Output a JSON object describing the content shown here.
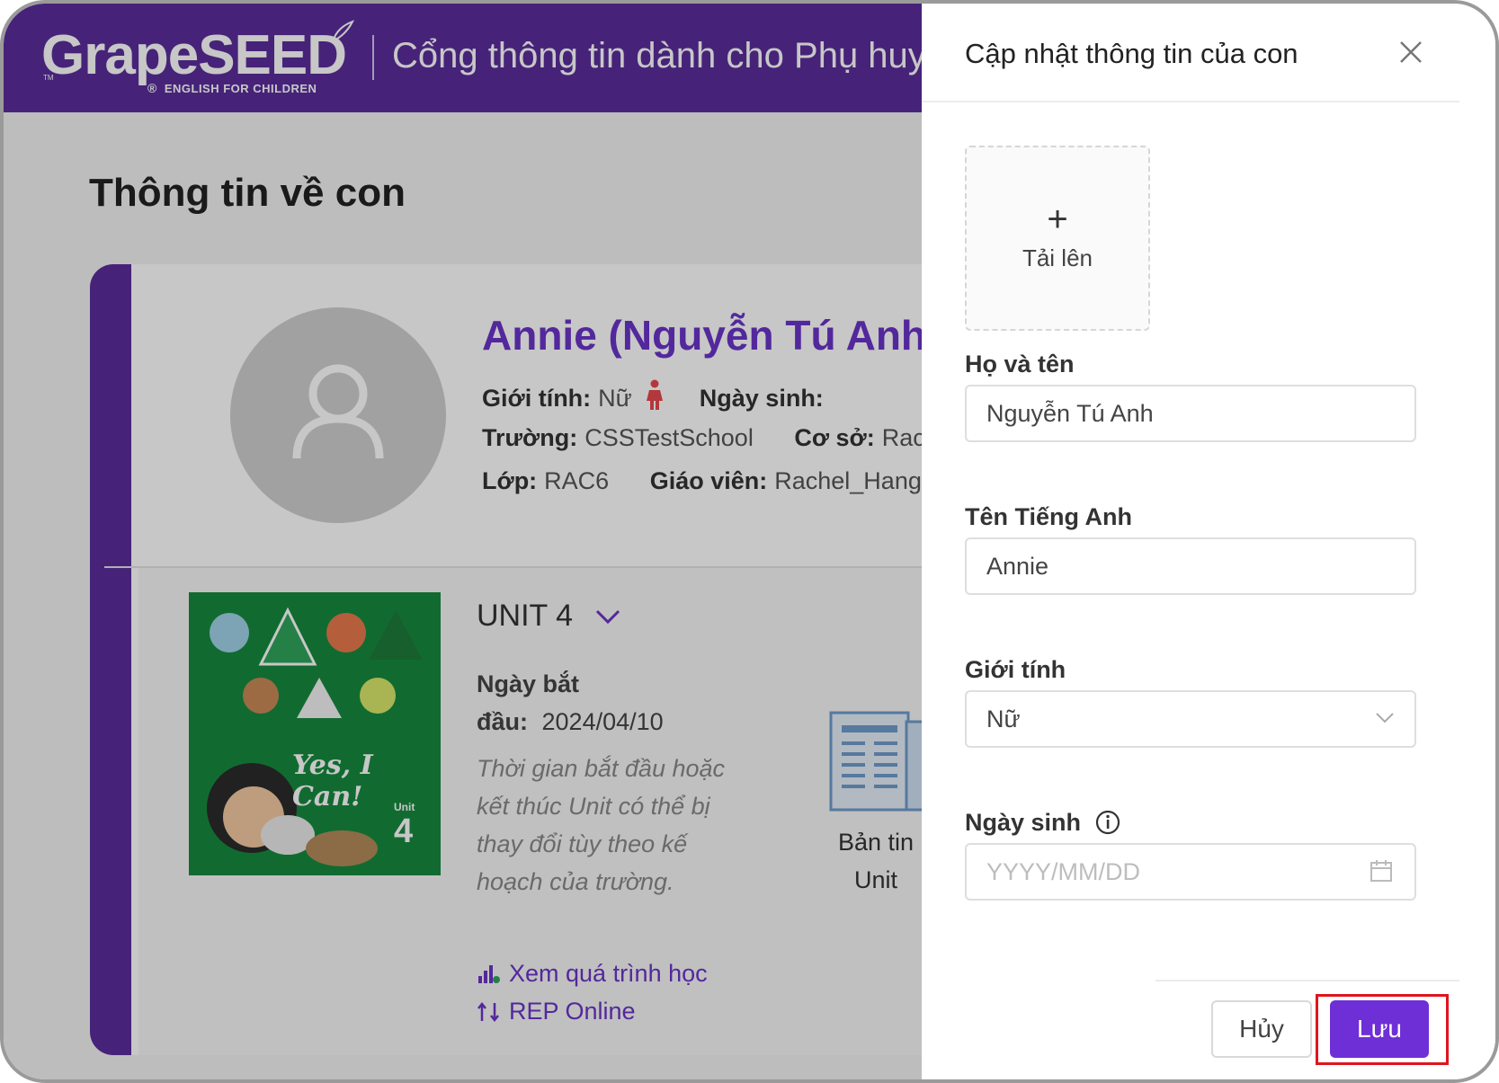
{
  "header": {
    "logo_text": "GrapeSEED",
    "logo_tm": "TM",
    "logo_tagline": "ENGLISH FOR CHILDREN",
    "portal_title": "Cổng thông tin dành cho Phụ huynh"
  },
  "page": {
    "title": "Thông tin về con"
  },
  "child": {
    "display_name": "Annie (Nguyễn Tú Anh)",
    "gender_label": "Giới tính:",
    "gender_value": "Nữ",
    "birthday_label": "Ngày sinh:",
    "birthday_value": "",
    "school_label": "Trường:",
    "school_value": "CSSTestSchool",
    "campus_label": "Cơ sở:",
    "campus_value": "Rachel",
    "class_label": "Lớp:",
    "class_value": "RAC6",
    "teacher_label": "Giáo viên:",
    "teacher_value": "Rachel_Hang"
  },
  "unit": {
    "title": "UNIT 4",
    "start_label_line1": "Ngày bắt",
    "start_label_line2": "đầu:",
    "start_date": "2024/04/10",
    "note": "Thời gian bắt đầu hoặc kết thúc Unit có thể bị thay đổi tùy theo kế hoạch của trường.",
    "view_progress_link": "Xem quá trình học",
    "rep_online_link": "REP Online",
    "newsletter_line1": "Bản tin",
    "newsletter_line2": "Unit",
    "book_title": "Yes, I Can!",
    "book_unit_label": "Unit",
    "book_unit_number": "4"
  },
  "drawer": {
    "title": "Cập nhật thông tin của con",
    "upload_label": "Tải lên",
    "full_name_label": "Họ và tên",
    "full_name_value": "Nguyễn Tú Anh",
    "english_name_label": "Tên Tiếng Anh",
    "english_name_value": "Annie",
    "gender_label": "Giới tính",
    "gender_selected": "Nữ",
    "birthday_label": "Ngày sinh",
    "birthday_placeholder": "YYYY/MM/DD",
    "cancel_label": "Hủy",
    "save_label": "Lưu"
  },
  "colors": {
    "brand_purple": "#5a2d9b",
    "accent_purple": "#6b34c8",
    "save_button": "#6f2fd6",
    "highlight_red": "#e0141e"
  },
  "icons": [
    "plus-icon",
    "close-icon",
    "edit-icon",
    "female-icon",
    "mail-icon",
    "chevron-down-icon",
    "chart-icon",
    "sync-icon",
    "newspaper-icon",
    "info-icon",
    "calendar-icon",
    "user-icon"
  ]
}
